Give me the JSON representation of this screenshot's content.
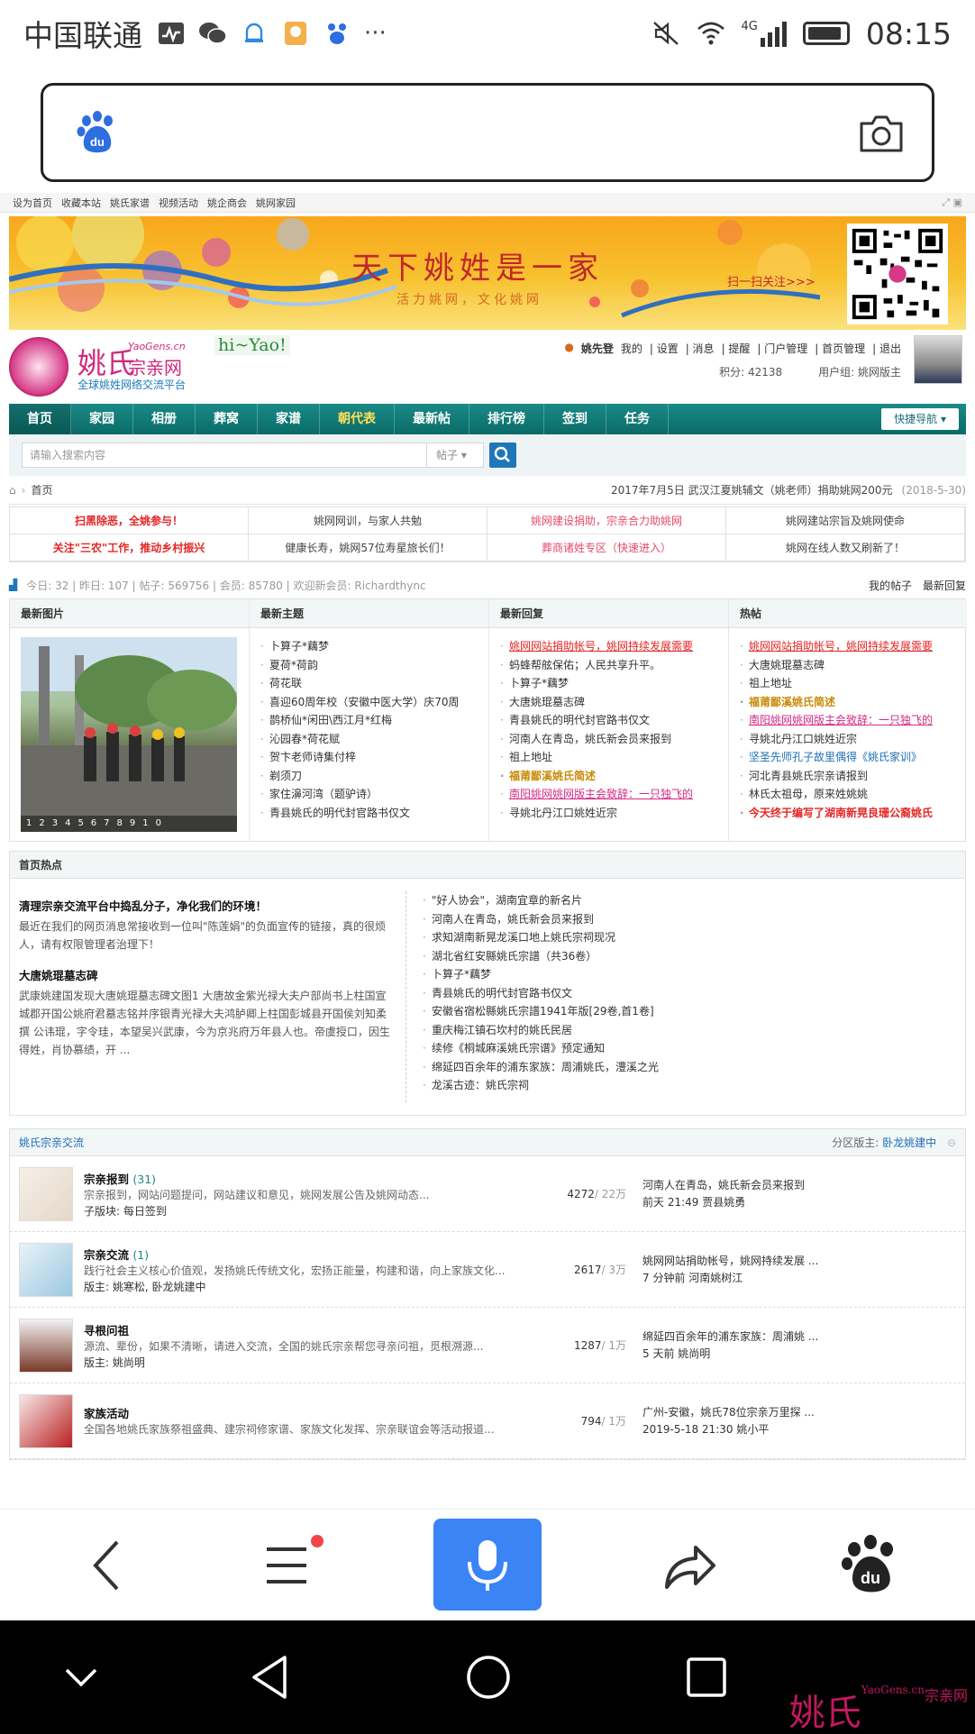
{
  "status": {
    "carrier": "中国联通",
    "network": "4G",
    "time": "08:15"
  },
  "search": {
    "placeholder": ""
  },
  "web": {
    "topnav": [
      "设为首页",
      "收藏本站",
      "姚氏家谱",
      "视频活动",
      "姚企商会",
      "姚网家园"
    ],
    "banner": {
      "slogan": "天下姚姓是一家",
      "sub": "活力姚网，文化姚网",
      "scan": "扫一扫关注>>>"
    },
    "logo": {
      "name": "姚氏",
      "domain": "YaoGens.cn",
      "site": "宗亲网",
      "tagline": "全球姚姓网络交流平台",
      "hi": "hi~Yao!"
    },
    "user": {
      "name": "姚先登",
      "links": [
        "我的",
        "设置",
        "消息",
        "提醒",
        "门户管理",
        "首页管理",
        "退出"
      ],
      "points": "积分: 42138",
      "group": "用户组: 姚网版主"
    },
    "mainnav": [
      "首页",
      "家园",
      "相册",
      "葬窝",
      "家谱",
      "朝代表",
      "最新帖",
      "排行榜",
      "签到",
      "任务"
    ],
    "quicknav": "快捷导航",
    "searchbar": {
      "placeholder": "请输入搜索内容",
      "select": "帖子"
    },
    "crumb": {
      "home": "首页",
      "news": "2017年7月5日 武汉江夏姚辅文（姚老师）捐助姚网200元",
      "date": "(2018-5-30)"
    },
    "promo": [
      {
        "text": "扫黑除恶，全姚参与！",
        "style": "red"
      },
      {
        "text": "姚网网训，与家人共勉",
        "style": ""
      },
      {
        "text": "姚网建设捐助，宗亲合力助姚网",
        "style": "pink"
      },
      {
        "text": "姚网建站宗旨及姚网使命",
        "style": ""
      },
      {
        "text": "关注\"三农\"工作，推动乡村振兴",
        "style": "red"
      },
      {
        "text": "健康长寿，姚网57位寿星旅长们！",
        "style": ""
      },
      {
        "text": "葬商诸姓专区（快速进入）",
        "style": "pink"
      },
      {
        "text": "姚网在线人数又刷新了！",
        "style": ""
      }
    ],
    "stats": {
      "text": "今日: 32 | 昨日: 107 | 帖子: 569756 | 会员: 85780 | 欢迎新会员: Richardthync",
      "links": [
        "我的帖子",
        "最新回复"
      ]
    },
    "columns": {
      "photo": {
        "title": "最新图片",
        "pager": "12345678910"
      },
      "newest": {
        "title": "最新主题",
        "items": [
          "卜算子*藕梦",
          "夏荷*荷韵",
          "荷花联",
          "喜迎60周年校（安徽中医大学）庆70周",
          "鹊桥仙*闲田\\西江月*红梅",
          "沁园春*荷花赋",
          "贺卞老师诗集付梓",
          "剃须刀",
          "家住濞河湾（题驴诗）",
          "青县姚氏的明代封官路书仅文"
        ]
      },
      "replies": {
        "title": "最新回复",
        "items": [
          {
            "text": "姚网网站捐助帐号，姚网持续发展需要",
            "style": "l-red"
          },
          {
            "text": "蚂蜂帮舷保佑；人民共享升平。",
            "style": ""
          },
          {
            "text": "卜算子*藕梦",
            "style": ""
          },
          {
            "text": "大唐姚琨墓志碑",
            "style": ""
          },
          {
            "text": "青县姚氏的明代封官路书仅文",
            "style": ""
          },
          {
            "text": "河南人在青岛，姚氏新会员来报到",
            "style": ""
          },
          {
            "text": "祖上地址",
            "style": ""
          },
          {
            "text": "福莆鄙溪姚氏简述",
            "style": "l-orange"
          },
          {
            "text": "南阳姚网姚网版主会致辞：一只独飞的",
            "style": "l-pink"
          },
          {
            "text": "寻姚北丹江口姚姓近宗",
            "style": ""
          }
        ]
      },
      "hot": {
        "title": "热帖",
        "items": [
          {
            "text": "姚网网站捐助帐号，姚网持续发展需要",
            "style": "l-red"
          },
          {
            "text": "大唐姚琨墓志碑",
            "style": ""
          },
          {
            "text": "祖上地址",
            "style": ""
          },
          {
            "text": "福莆鄙溪姚氏简述",
            "style": "l-orange"
          },
          {
            "text": "南阳姚网姚网版主会致辞：一只独飞的",
            "style": "l-pink"
          },
          {
            "text": "寻姚北丹江口姚姓近宗",
            "style": ""
          },
          {
            "text": "坚圣先师孔子故里偶得《姚氏家训》",
            "style": "l-blue"
          },
          {
            "text": "河北青县姚氏宗亲请报到",
            "style": ""
          },
          {
            "text": "林氏太祖母，原来姓姚姚",
            "style": ""
          },
          {
            "text": "今天终于编写了湖南新晃良珊公裔姚氏",
            "style": "l-redb"
          }
        ]
      }
    },
    "hotbox": {
      "title": "首页热点",
      "h1": "清理宗亲交流平台中捣乱分子，净化我们的环境！",
      "p1": "最近在我们的网页消息常接收到一位叫\"陈莲娟\"的负面宣传的链接，真的很烦人，请有权限管理者治理下！",
      "h2": "大唐姚琨墓志碑",
      "p2": "武康姚建国发现大唐姚琨墓志碑文图1 大唐故金紫光禄大夫户部尚书上柱国宣城郡开国公姚府君墓志铭并序银青光禄大夫鸿胪卿上柱国彭城县开国侯刘知柔撰 公讳琨，字令珪，本望吴兴武康，今为京兆府万年县人也。帝虞授口，因生得姓，肖协慕绩，开 ...",
      "list": [
        "\"好人协会\"，湖南宜章的新名片",
        "河南人在青岛，姚氏新会员来报到",
        "求知湖南新晃龙溪口地上姚氏宗祠现况",
        "湖北省红安縣姚氏宗譜（共36卷）",
        "卜算子*藕梦",
        "青县姚氏的明代封官路书仅文",
        "安徽省宿松縣姚氏宗譜1941年版[29卷,首1卷]",
        "重庆梅江镇石坎村的姚氏民居",
        "续修《桐城麻溪姚氏宗谱》预定通知",
        "绵延四百余年的浦东家族：周浦姚氏，澧溪之光",
        "龙溪古迹：姚氏宗祠"
      ]
    },
    "forum": {
      "title": "姚氏宗亲交流",
      "mod_label": "分区版主:",
      "mod_name": "卧龙姚建中",
      "rows": [
        {
          "title": "宗亲报到",
          "count": "(31)",
          "desc": "宗亲报到，网站问题提问，网站建议和意见，姚网发展公告及姚网动态...",
          "meta": "子版块: 每日签到",
          "num": "4272",
          "total": "/ 22万",
          "last": "河南人在青岛，姚氏新会员来报到",
          "lastmeta": "前天 21:49 贾县姚勇"
        },
        {
          "title": "宗亲交流",
          "count": "(1)",
          "desc": "践行社会主义核心价值观，发扬姚氏传统文化，宏扬正能量，构建和谐，向上家族文化...",
          "meta": "版主: 姚寒松, 卧龙姚建中",
          "num": "2617",
          "total": "/ 3万",
          "last": "姚网网站捐助帐号，姚网持续发展 ...",
          "lastmeta": "7 分钟前 河南姚树江"
        },
        {
          "title": "寻根问祖",
          "count": "",
          "desc": "源流、辈份，如果不清晰，请进入交流，全国的姚氏宗亲帮您寻亲问祖，觅根溯源...",
          "meta": "版主: 姚尚明",
          "num": "1287",
          "total": "/ 1万",
          "last": "绵延四百余年的浦东家族：周浦姚 ...",
          "lastmeta": "5 天前 姚尚明"
        },
        {
          "title": "家族活动",
          "count": "",
          "desc": "全国各地姚氏家族祭祖盛典、建宗祠修家谱、家族文化发挥、宗亲联谊会等活动报道...",
          "meta": "",
          "num": "794",
          "total": "/ 1万",
          "last": "广州-安徽，姚氏78位宗亲万里探 ...",
          "lastmeta": "2019-5-18 21:30 姚小平"
        }
      ]
    }
  },
  "watermark": {
    "name": "姚氏",
    "domain": "YaoGens.cn",
    "site": "宗亲网"
  }
}
